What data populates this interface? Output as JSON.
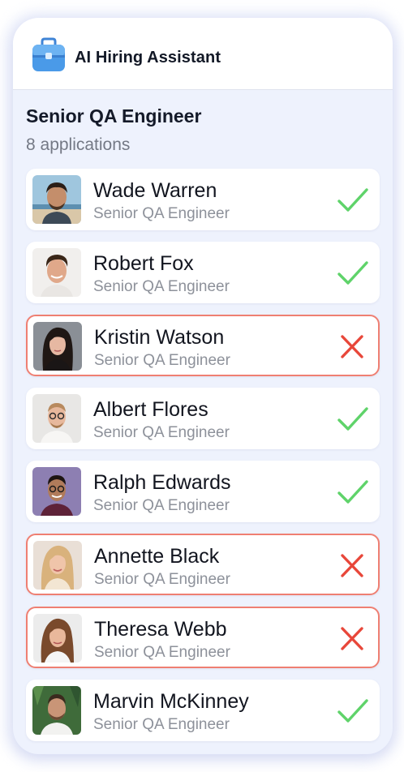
{
  "app": {
    "title": "AI Hiring Assistant",
    "icon": "briefcase-icon"
  },
  "job": {
    "title": "Senior QA Engineer",
    "applications_label": "8 applications"
  },
  "colors": {
    "accept": "#5fd36a",
    "reject": "#e8473a",
    "reject_border": "#ef7f72",
    "card_background": "#eef2fd",
    "icon_blue": "#4a9ae8"
  },
  "candidates": [
    {
      "name": "Wade Warren",
      "role": "Senior QA Engineer",
      "status": "accepted",
      "status_icon": "check-icon"
    },
    {
      "name": "Robert Fox",
      "role": "Senior QA Engineer",
      "status": "accepted",
      "status_icon": "check-icon"
    },
    {
      "name": "Kristin Watson",
      "role": "Senior QA Engineer",
      "status": "rejected",
      "status_icon": "cross-icon"
    },
    {
      "name": "Albert Flores",
      "role": "Senior QA Engineer",
      "status": "accepted",
      "status_icon": "check-icon"
    },
    {
      "name": "Ralph Edwards",
      "role": "Senior QA Engineer",
      "status": "accepted",
      "status_icon": "check-icon"
    },
    {
      "name": "Annette Black",
      "role": "Senior QA Engineer",
      "status": "rejected",
      "status_icon": "cross-icon"
    },
    {
      "name": "Theresa Webb",
      "role": "Senior QA Engineer",
      "status": "rejected",
      "status_icon": "cross-icon"
    },
    {
      "name": "Marvin McKinney",
      "role": "Senior QA Engineer",
      "status": "accepted",
      "status_icon": "check-icon"
    }
  ]
}
